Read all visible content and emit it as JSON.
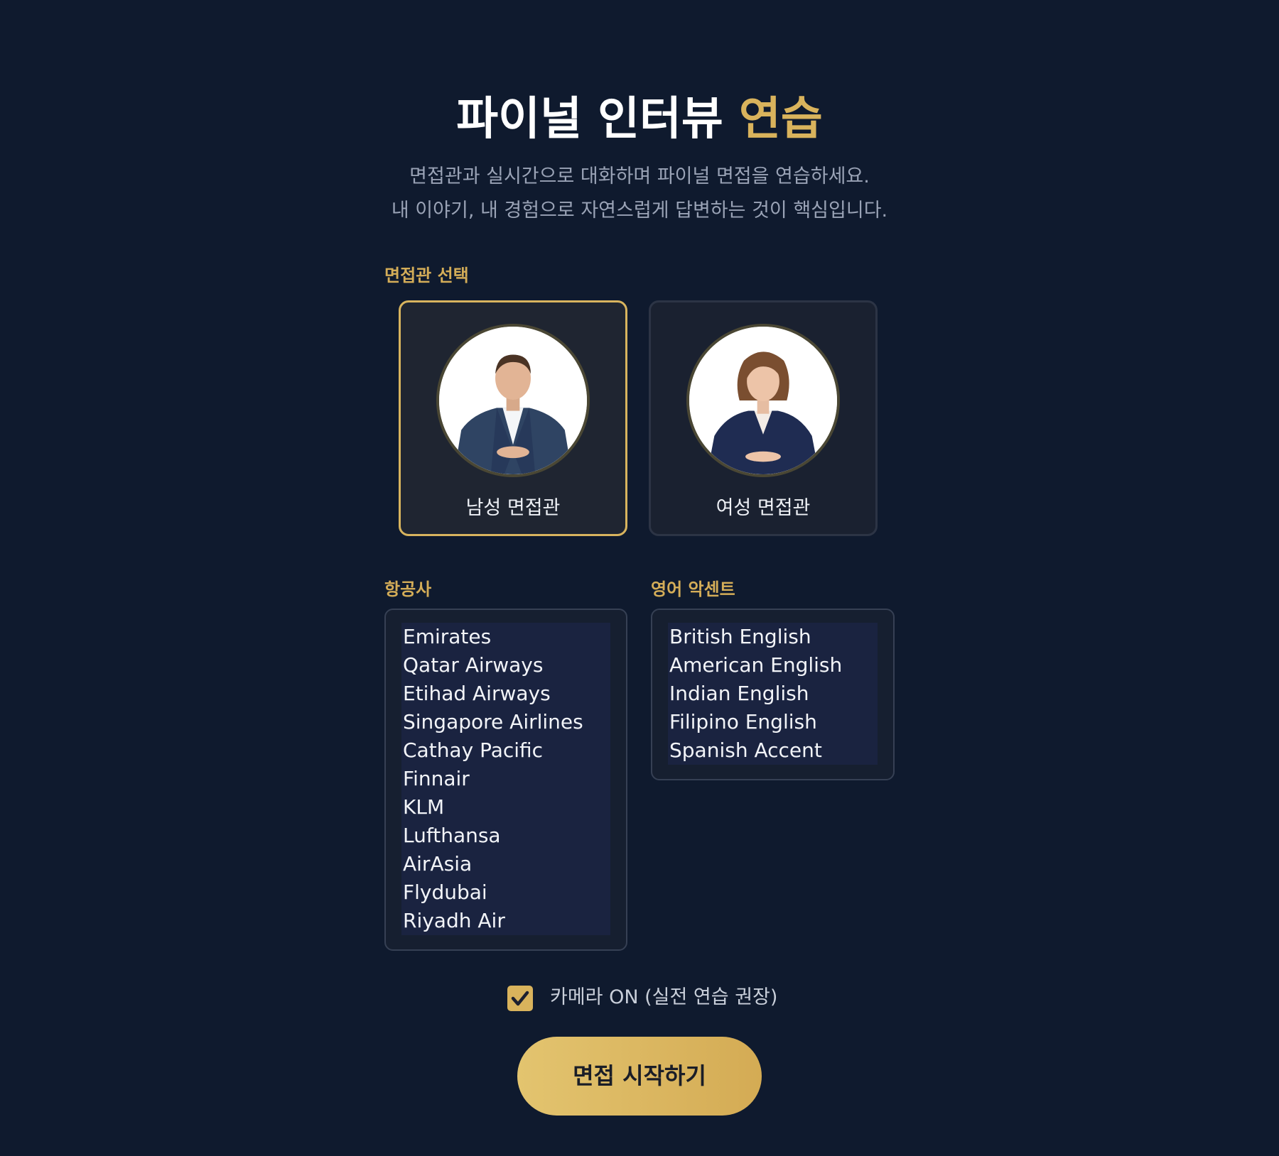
{
  "header": {
    "title_main": "파이널 인터뷰",
    "title_accent": "연습",
    "subtitle_line1": "면접관과 실시간으로 대화하며 파이널 면접을 연습하세요.",
    "subtitle_line2": "내 이야기, 내 경험으로 자연스럽게 답변하는 것이 핵심입니다."
  },
  "interviewer": {
    "section_label": "면접관 선택",
    "options": [
      {
        "label": "남성 면접관",
        "selected": true
      },
      {
        "label": "여성 면접관",
        "selected": false
      }
    ]
  },
  "airline": {
    "section_label": "항공사",
    "options": [
      "Emirates",
      "Qatar Airways",
      "Etihad Airways",
      "Singapore Airlines",
      "Cathay Pacific",
      "Finnair",
      "KLM",
      "Lufthansa",
      "AirAsia",
      "Flydubai",
      "Riyadh Air"
    ]
  },
  "accent": {
    "section_label": "영어 악센트",
    "options": [
      "British English",
      "American English",
      "Indian English",
      "Filipino English",
      "Spanish Accent"
    ]
  },
  "camera": {
    "label": "카메라 ON (실전 연습 권장)",
    "checked": true
  },
  "start_button": {
    "label": "면접 시작하기"
  },
  "colors": {
    "background": "#0f1a2e",
    "accent_gold": "#d9b35c"
  }
}
